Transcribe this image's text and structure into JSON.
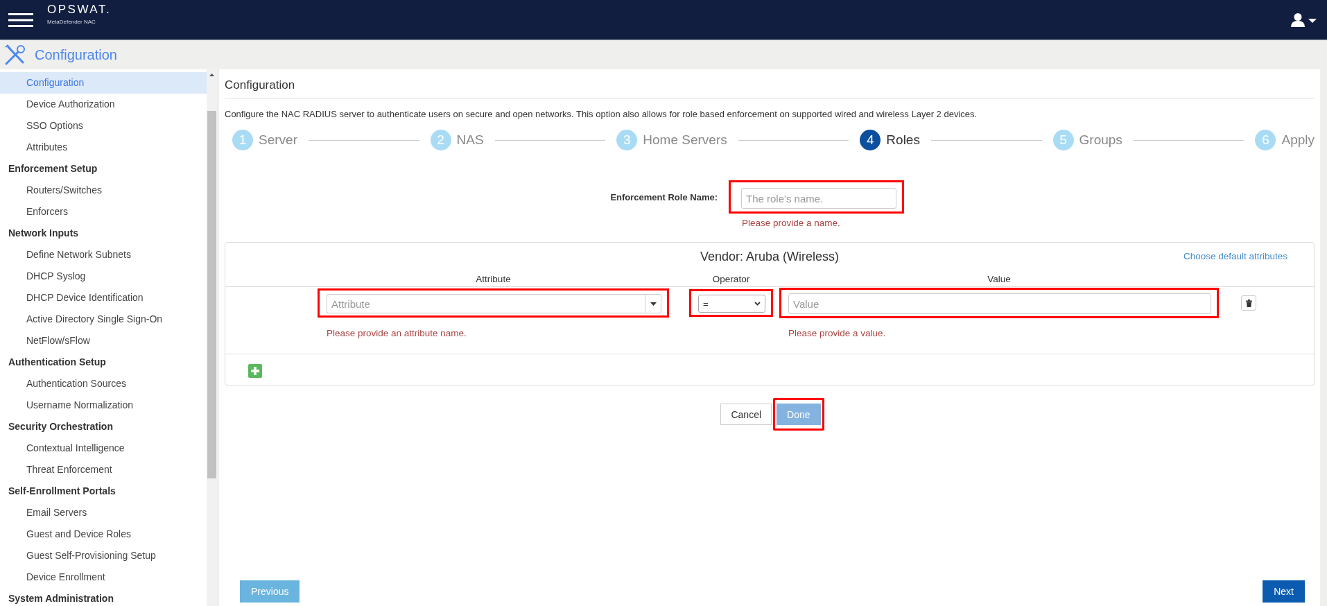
{
  "header": {
    "logo": "OPSWAT.",
    "product": "MetaDefender NAC"
  },
  "section_bar": {
    "title": "Configuration"
  },
  "sidebar": {
    "sections": [
      {
        "items": [
          {
            "label": "Configuration",
            "selected": true
          },
          {
            "label": "Device Authorization",
            "selected": false
          },
          {
            "label": "SSO Options",
            "selected": false
          },
          {
            "label": "Attributes",
            "selected": false
          }
        ]
      },
      {
        "title": "Enforcement Setup",
        "items": [
          {
            "label": "Routers/Switches",
            "selected": false
          },
          {
            "label": "Enforcers",
            "selected": false
          }
        ]
      },
      {
        "title": "Network Inputs",
        "items": [
          {
            "label": "Define Network Subnets",
            "selected": false
          },
          {
            "label": "DHCP Syslog",
            "selected": false
          },
          {
            "label": "DHCP Device Identification",
            "selected": false
          },
          {
            "label": "Active Directory Single Sign-On",
            "selected": false
          },
          {
            "label": "NetFlow/sFlow",
            "selected": false
          }
        ]
      },
      {
        "title": "Authentication Setup",
        "items": [
          {
            "label": "Authentication Sources",
            "selected": false
          },
          {
            "label": "Username Normalization",
            "selected": false
          }
        ]
      },
      {
        "title": "Security Orchestration",
        "items": [
          {
            "label": "Contextual Intelligence",
            "selected": false
          },
          {
            "label": "Threat Enforcement",
            "selected": false
          }
        ]
      },
      {
        "title": "Self-Enrollment Portals",
        "items": [
          {
            "label": "Email Servers",
            "selected": false
          },
          {
            "label": "Guest and Device Roles",
            "selected": false
          },
          {
            "label": "Guest Self-Provisioning Setup",
            "selected": false
          },
          {
            "label": "Device Enrollment",
            "selected": false
          }
        ]
      },
      {
        "title": "System Administration"
      }
    ]
  },
  "page": {
    "title": "Configuration",
    "description": "Configure the NAC RADIUS server to authenticate users on secure and open networks. This option also allows for role based enforcement on supported wired and wireless Layer 2 devices.",
    "steps": [
      {
        "number": "1",
        "label": "Server",
        "selected": false
      },
      {
        "number": "2",
        "label": "NAS",
        "selected": false
      },
      {
        "number": "3",
        "label": "Home Servers",
        "selected": false
      },
      {
        "number": "4",
        "label": "Roles",
        "selected": true
      },
      {
        "number": "5",
        "label": "Groups",
        "selected": false
      },
      {
        "number": "6",
        "label": "Apply",
        "selected": false
      }
    ]
  },
  "role_form": {
    "label": "Enforcement Role Name:",
    "placeholder": "The role's name.",
    "error": "Please provide a name.",
    "highlighted": true
  },
  "vendor_panel": {
    "title": "Vendor: Aruba (Wireless)",
    "link": "Choose default attributes",
    "columns": [
      "Attribute",
      "Operator",
      "Value"
    ],
    "rows": [
      {
        "attribute": {
          "placeholder": "Attribute",
          "error": "Please provide an attribute name.",
          "highlighted": true
        },
        "operator": {
          "value": "=",
          "highlighted": true
        },
        "value": {
          "placeholder": "Value",
          "error": "Please provide a value.",
          "highlighted": true
        }
      }
    ]
  },
  "dialog_buttons": [
    {
      "label": "Cancel",
      "kind": "default",
      "disabled": false,
      "highlighted": false
    },
    {
      "label": "Done",
      "kind": "primary",
      "disabled": true,
      "highlighted": true
    }
  ],
  "footer_buttons": [
    {
      "label": "Previous",
      "disabled": true
    },
    {
      "label": "Next",
      "disabled": false
    }
  ]
}
